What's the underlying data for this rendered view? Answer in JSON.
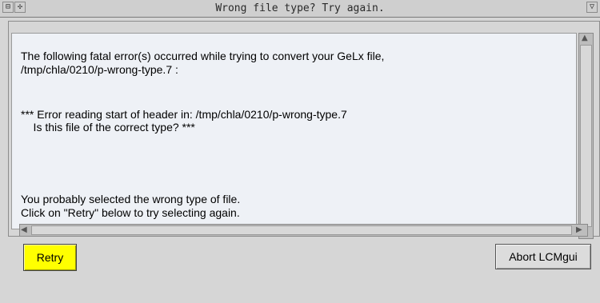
{
  "window": {
    "title": "Wrong file type?  Try again.",
    "menu_glyph": "⊟",
    "resize_glyph": "✣",
    "close_glyph": "▽"
  },
  "message": {
    "line1": "The following fatal error(s) occurred while trying to convert your GeLx file,",
    "line2": "/tmp/chla/0210/p-wrong-type.7 :",
    "line3": "*** Error reading start of header in: /tmp/chla/0210/p-wrong-type.7",
    "line4": "    Is this file of the correct type? ***",
    "line5": "You probably selected the wrong type of file.",
    "line6": "Click on \"Retry\" below to try selecting again."
  },
  "buttons": {
    "retry": "Retry",
    "abort": "Abort LCMgui"
  },
  "colors": {
    "retry_bg": "#ffff00",
    "text_bg": "#eef1f6"
  }
}
